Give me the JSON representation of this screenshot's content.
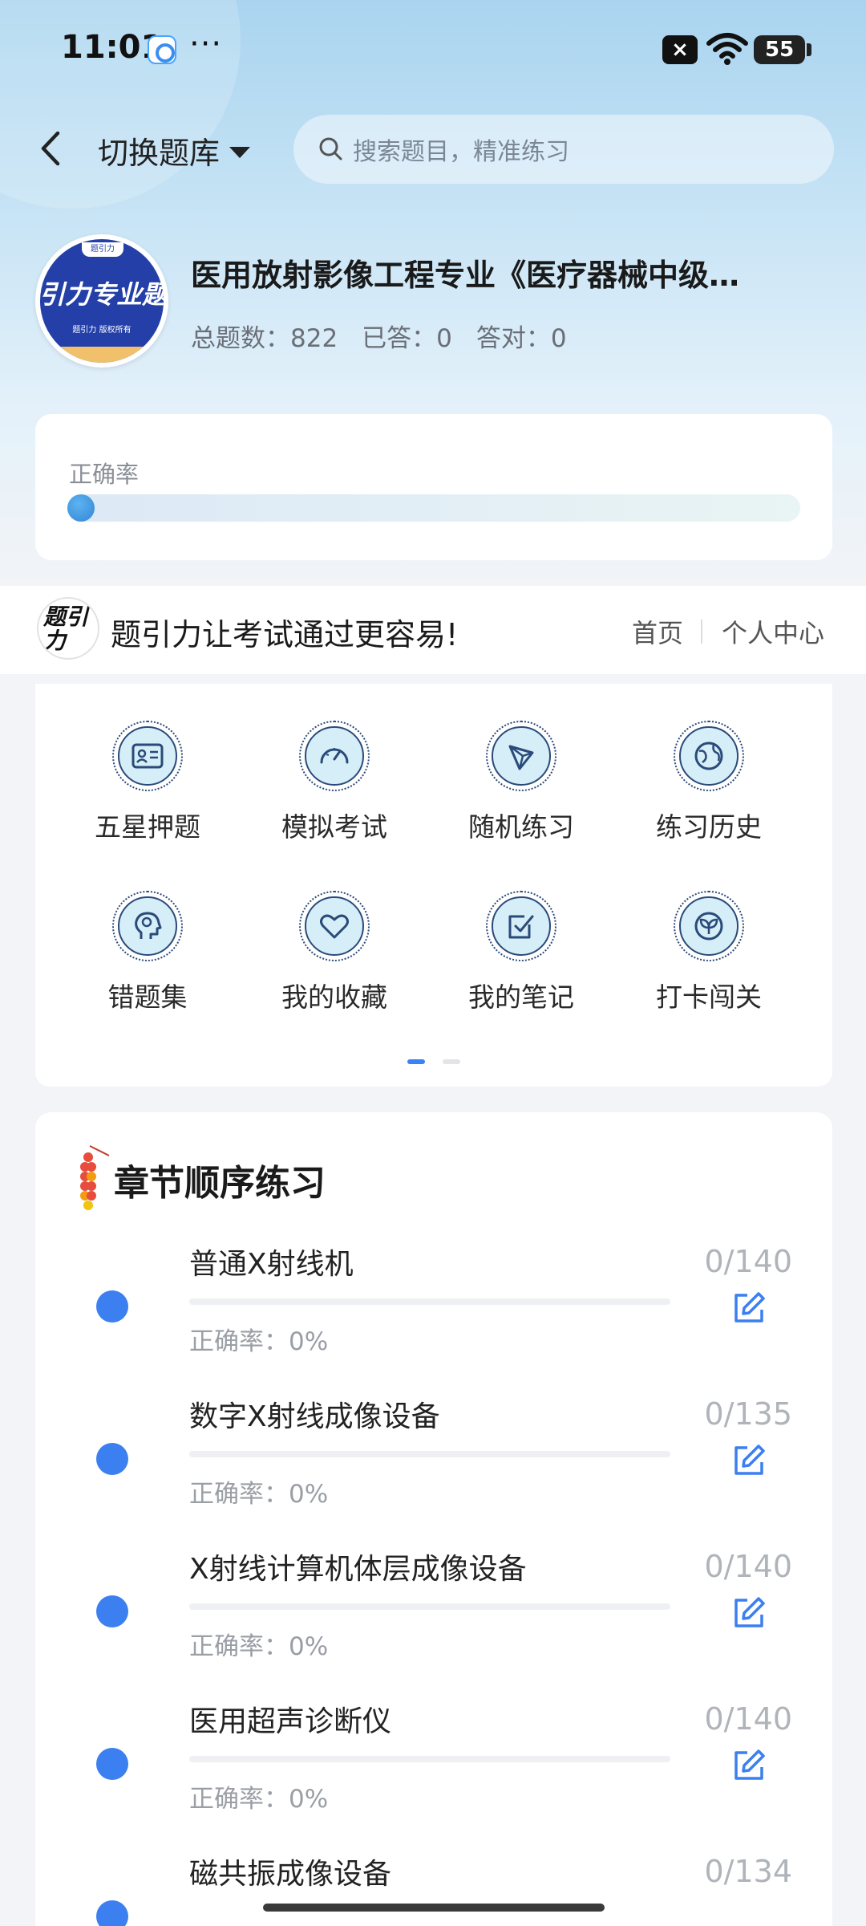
{
  "status": {
    "time": "11:01",
    "more": "···",
    "sim_icon": "×",
    "battery": "55"
  },
  "header": {
    "switch_label": "切换题库",
    "search_placeholder": "搜索题目，精准练习"
  },
  "bank": {
    "logo_top": "题引力",
    "logo_text": "引力专业题",
    "logo_sub": "题引力 版权所有",
    "title": "医用放射影像工程专业《医疗器械中级…",
    "stats": [
      "总题数：822",
      "已答：0",
      "答对：0"
    ]
  },
  "accuracy": {
    "label": "正确率",
    "value": 0
  },
  "brand": {
    "logo_text": "题引力",
    "slogan": "题引力让考试通过更容易!",
    "home": "首页",
    "profile": "个人中心"
  },
  "functions": [
    {
      "label": "五星押题",
      "icon": "id-card-icon"
    },
    {
      "label": "模拟考试",
      "icon": "speedometer-icon"
    },
    {
      "label": "随机练习",
      "icon": "network-icon"
    },
    {
      "label": "练习历史",
      "icon": "globe-icon"
    },
    {
      "label": "错题集",
      "icon": "head-icon"
    },
    {
      "label": "我的收藏",
      "icon": "heart-icon"
    },
    {
      "label": "我的笔记",
      "icon": "checkbox-icon"
    },
    {
      "label": "打卡闯关",
      "icon": "leaf-icon"
    }
  ],
  "pager": {
    "active": 0,
    "count": 2
  },
  "chapters": {
    "title": "章节顺序练习",
    "items": [
      {
        "name": "普通X射线机",
        "accuracy": "正确率：0%",
        "count": "0/140"
      },
      {
        "name": "数字X射线成像设备",
        "accuracy": "正确率：0%",
        "count": "0/135"
      },
      {
        "name": "X射线计算机体层成像设备",
        "accuracy": "正确率：0%",
        "count": "0/140"
      },
      {
        "name": "医用超声诊断仪",
        "accuracy": "正确率：0%",
        "count": "0/140"
      },
      {
        "name": "磁共振成像设备",
        "accuracy": "",
        "count": "0/134"
      }
    ]
  },
  "colors": {
    "accent": "#3b7ff0",
    "icon_stroke": "#2a4a79",
    "icon_fill": "#d6eef7"
  }
}
